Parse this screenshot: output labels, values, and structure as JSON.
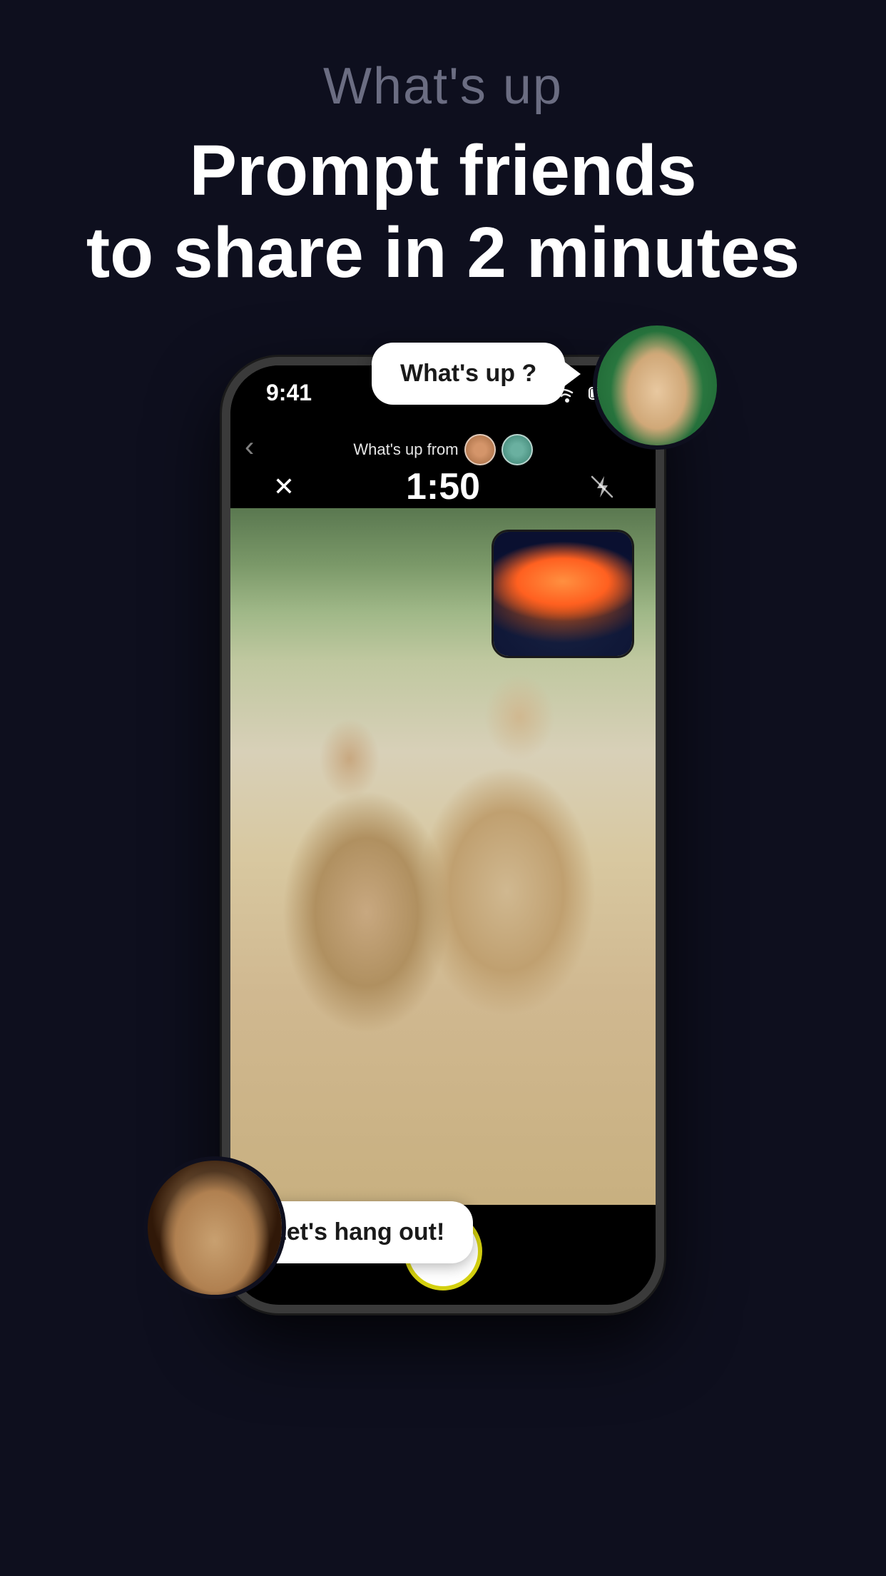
{
  "page": {
    "bg_color": "#0e0f1e",
    "top_label": "What's up",
    "headline_line1": "Prompt friends",
    "headline_line2": "to share in 2 minutes"
  },
  "phone": {
    "status_time": "9:41",
    "whats_up_from_text": "What's up from",
    "timer": "1:50",
    "back_arrow": "‹",
    "close_x": "✕",
    "flash_off": "⚡"
  },
  "bubbles": {
    "top_bubble": "What's up ?",
    "bottom_bubble": "Let's hang out!"
  },
  "icons": {
    "close": "✕",
    "flash": "⚡",
    "back": "‹"
  }
}
